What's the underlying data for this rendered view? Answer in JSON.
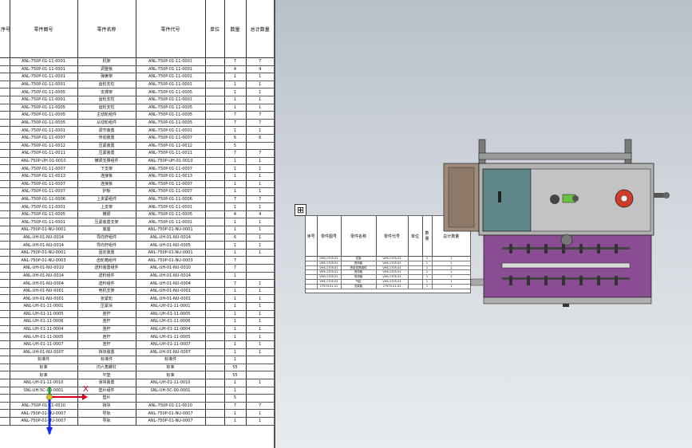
{
  "bom": {
    "headers": [
      "序号",
      "零件图号",
      "零件名称",
      "零件代号",
      "单位",
      "数量",
      "总计数量"
    ],
    "rows": [
      [
        "",
        "ANL-750P-01-11-0001",
        "机架",
        "ANL-750P-01-11-0001",
        "",
        "7",
        "7"
      ],
      [
        "",
        "ANL-750P-01-11-0001",
        "调整板",
        "ANL-750P-01-11-0001",
        "",
        "4",
        "4"
      ],
      [
        "",
        "ANL-750P-01-11-0001",
        "弹簧架",
        "ANL-750P-01-11-0001",
        "",
        "1",
        "1"
      ],
      [
        "",
        "ANL-750P-01-11-0001",
        "齿轮支柱",
        "ANL-750P-01-11-0001",
        "",
        "1",
        "1"
      ],
      [
        "",
        "ANL-750P-01-11-0005",
        "支撑架",
        "ANL-750P-01-11-0005",
        "",
        "1",
        "1"
      ],
      [
        "",
        "ANL-750P-01-11-0001",
        "齿轮支柱",
        "ANL-750P-01-11-0001",
        "",
        "1",
        "1"
      ],
      [
        "",
        "ANL-750P-01-11-0005",
        "齿轮支柱",
        "ANL-750P-01-11-0005",
        "",
        "1",
        "1"
      ],
      [
        "",
        "ANL-750P-01-11-0005",
        "主动轮组件",
        "ANL-750P-01-11-0005",
        "",
        "7",
        "7"
      ],
      [
        "",
        "ANL-750P-01-11-0005",
        "从动轮组件",
        "ANL-750P-01-11-0005",
        "",
        "7",
        "7"
      ],
      [
        "",
        "ANL-750P-01-11-0001",
        "调节装置",
        "ANL-750P-01-11-0001",
        "",
        "1",
        "1"
      ],
      [
        "",
        "ANL-750P-01-11-0007",
        "传动装置",
        "ANL-750P-01-11-0007",
        "",
        "6",
        "6"
      ],
      [
        "",
        "ANL-750P-01-11-0012",
        "压紧装置",
        "ANL-750P-01-11-0012",
        "",
        "5",
        ""
      ],
      [
        "",
        "ANL-750P-01-11-0011",
        "压紧装置",
        "ANL-750P-01-11-0011",
        "",
        "7",
        "7"
      ],
      [
        "",
        "ANL-750P-UH-01-0010",
        "横梁支撑组件",
        "ANL-750P-UH-01-0010",
        "",
        "1",
        "1"
      ],
      [
        "",
        "ANL-750P-01-11-0007",
        "下支架",
        "ANL-750P-01-11-0007",
        "",
        "1",
        "1"
      ],
      [
        "",
        "ANL-750P-01-11-0013",
        "连接板",
        "ANL-750P-01-11-0013",
        "",
        "1",
        "1"
      ],
      [
        "",
        "ANL-750P-01-11-0007",
        "连接板",
        "ANL-750P-01-11-0007",
        "",
        "1",
        "1"
      ],
      [
        "",
        "ANL-750P-01-11-0007",
        "护板",
        "ANL-750P-01-11-0007",
        "",
        "1",
        "1"
      ],
      [
        "",
        "ANL-750P-01-11-0006",
        "上夹紧组件",
        "ANL-750P-01-11-0006",
        "",
        "7",
        "7"
      ],
      [
        "",
        "ANL-750P-01-11-0001",
        "上支架",
        "ANL-750P-01-11-0001",
        "",
        "1",
        "1"
      ],
      [
        "",
        "ANL-750P-01-11-0005",
        "横梁",
        "ANL-750P-01-11-0005",
        "",
        "4",
        "4"
      ],
      [
        "",
        "ANL-750P-01-11-0001",
        "压紧装置支架",
        "ANL-750P-01-11-0001",
        "",
        "1",
        "1"
      ],
      [
        "",
        "ANL-750P-01-NU-0001",
        "底座",
        "ANL-750P-01-NU-0001",
        "",
        "1",
        "1"
      ],
      [
        "",
        "ANL-UH-01-NU-0014",
        "导向杆组件",
        "ANL-UH-01-NU-0014",
        "",
        "6",
        "1"
      ],
      [
        "",
        "ANL-UH-01-NU-0014",
        "导向杆组件",
        "ANL-UH-01-NU-0005",
        "",
        "1",
        "1"
      ],
      [
        "",
        "ANL-750P-01-NU-0001",
        "固定装置",
        "ANL-750P-01-NU-0001",
        "",
        "1",
        "1"
      ],
      [
        "",
        "ANL-750P-01-NU-0003",
        "齿轮箱组件",
        "ANL-750P-01-NU-0003",
        "",
        "7",
        ""
      ],
      [
        "",
        "ANL-UH-01-NU-0010",
        "送料装置组件",
        "ANL-UH-01-NU-0010",
        "",
        "7",
        ""
      ],
      [
        "",
        "ANL-UH-01-NU-0014",
        "送料组件",
        "ANL-UH-01-NU-0014",
        "",
        "1",
        ""
      ],
      [
        "",
        "ANL-UH-01-NU-0004",
        "送料组件",
        "ANL-UH-01-NU-0004",
        "",
        "7",
        "1"
      ],
      [
        "",
        "ANL-UH-01-NU-0001",
        "电机支架",
        "ANL-UH-01-NU-0001",
        "",
        "1",
        "1"
      ],
      [
        "",
        "ANL-UH-01-NU-0001",
        "张紧轮",
        "ANL-UH-01-NU-0001",
        "",
        "1",
        "1"
      ],
      [
        "",
        "ANL-UH-01-11-0001",
        "压紧块",
        "ANL-UH-01-11-0001",
        "",
        "1",
        "1"
      ],
      [
        "",
        "ANL-UH-01-11-0005",
        "连杆",
        "ANL-UH-01-11-0005",
        "",
        "1",
        "1"
      ],
      [
        "",
        "ANL-UH-01-11-0006",
        "连杆",
        "ANL-UH-01-11-0006",
        "",
        "1",
        "1"
      ],
      [
        "",
        "ANL-UH-01-11-0004",
        "连杆",
        "ANL-UH-01-11-0004",
        "",
        "1",
        "1"
      ],
      [
        "",
        "ANL-UH-01-11-0005",
        "连杆",
        "ANL-UH-01-11-0005",
        "",
        "1",
        "1"
      ],
      [
        "",
        "ANL-UH-01-11-0007",
        "连杆",
        "ANL-UH-01-11-0007",
        "",
        "1",
        "1"
      ],
      [
        "",
        "ANL-UH-01-NU-0007",
        "挡块装置",
        "ANL-UH-01-NU-0007",
        "",
        "1",
        "1"
      ],
      [
        "",
        "标准件",
        "标准件",
        "标准件",
        "",
        "1",
        ""
      ],
      [
        "",
        "标准",
        "内六角螺钉",
        "标准",
        "",
        "55",
        ""
      ],
      [
        "",
        "标准",
        "平垫",
        "标准",
        "",
        "55",
        ""
      ],
      [
        "",
        "ANL-UH-01-11-0010",
        "滑块装置",
        "ANL-UH-01-11-0010",
        "",
        "1",
        "1"
      ],
      [
        "",
        "SNL-UH-5C-00-0001",
        "垫片组件",
        "SNL-UH-5C-00-0001",
        "",
        "1",
        ""
      ],
      [
        "",
        "",
        "垫片",
        "",
        "",
        "5",
        ""
      ],
      [
        "",
        "ANL-750P-01-11-0010",
        "挡块",
        "ANL-750P-01-11-0010",
        "",
        "7",
        "7"
      ],
      [
        "",
        "ANL-750P-01-NU-0007",
        "导轨",
        "ANL-750P-01-NU-0007",
        "",
        "1",
        "1"
      ],
      [
        "",
        "ANL-750P-01-NU-0007",
        "导轨",
        "ANL-750P-01-NU-0007",
        "",
        "1",
        "1"
      ]
    ]
  },
  "small_bom": {
    "headers": [
      "序号",
      "零件图号",
      "零件名称",
      "零件代号",
      "单位",
      "数量",
      "总计数量"
    ],
    "rows": [
      [
        "",
        "VHS-1705-01",
        "支架",
        "VHS-1705-01",
        "",
        "1",
        "1"
      ],
      [
        "",
        "VHS-1705-01",
        "夹持板",
        "VHS-1705-01",
        "",
        "1",
        "1"
      ],
      [
        "",
        "VHS-1705-01",
        "夹持支撑组件",
        "VHS-1705-01",
        "",
        "1",
        "1"
      ],
      [
        "",
        "VHS-1705-01",
        "夹持板",
        "VHS-1705-01",
        "",
        "1",
        "1"
      ],
      [
        "",
        "VHS-1705-01",
        "夹持板",
        "VHS-1705-01",
        "",
        "1",
        "1"
      ],
      [
        "",
        "VHS-1705-01",
        "气缸",
        "VHS-1705-01",
        "",
        "1",
        "1"
      ],
      [
        "",
        "17570-01-01",
        "支架板",
        "17570-01-01",
        "",
        "1",
        "1"
      ]
    ]
  },
  "axes": {
    "x": "X",
    "y": "Y"
  },
  "move_handle_glyph": "⊞",
  "colors": {
    "viewport_top": "#b9c0c9",
    "machine_purple": "#8a4d94",
    "machine_teal": "#5f8688",
    "accent_red": "#d23a2a",
    "axis_x": "#d4001a",
    "axis_y": "#1a2ae8",
    "axis_z": "#1aa02a"
  }
}
